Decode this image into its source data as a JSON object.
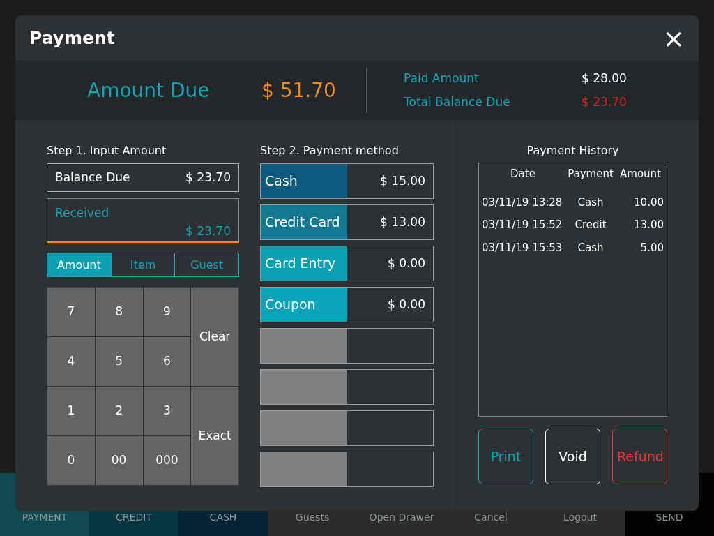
{
  "bottom_bar": [
    {
      "label": "PAYMENT",
      "color": "#0e4a50"
    },
    {
      "label": "CREDIT",
      "color": "#063640"
    },
    {
      "label": "CASH",
      "color": "#052535"
    },
    {
      "label": "Guests",
      "color": "#2b2b2b"
    },
    {
      "label": "Open Drawer",
      "color": "#2b2b2b"
    },
    {
      "label": "Cancel",
      "color": "#2b2b2b"
    },
    {
      "label": "Logout",
      "color": "#2b2b2b"
    },
    {
      "label": "SEND",
      "color": "#000000"
    }
  ],
  "dialog": {
    "title": "Payment",
    "close": "×",
    "summary": {
      "amount_due_label": "Amount Due",
      "amount_due": "$ 51.70",
      "paid_label": "Paid Amount",
      "paid": "$ 28.00",
      "balance_label": "Total Balance Due",
      "balance": "$ 23.70"
    },
    "step1": {
      "title": "Step 1. Input Amount",
      "balance_label": "Balance Due",
      "balance": "$ 23.70",
      "received_label": "Received",
      "received": "$ 23.70",
      "tabs": [
        {
          "label": "Amount",
          "selected": true
        },
        {
          "label": "Item",
          "selected": false
        },
        {
          "label": "Guest",
          "selected": false
        }
      ],
      "keys": [
        {
          "label": "7",
          "kind": "digit"
        },
        {
          "label": "8",
          "kind": "digit"
        },
        {
          "label": "9",
          "kind": "digit"
        },
        {
          "label": "Clear",
          "kind": "tall"
        },
        {
          "label": "4",
          "kind": "digit"
        },
        {
          "label": "5",
          "kind": "digit"
        },
        {
          "label": "6",
          "kind": "digit"
        },
        {
          "label": "1",
          "kind": "digit"
        },
        {
          "label": "2",
          "kind": "digit"
        },
        {
          "label": "3",
          "kind": "digit"
        },
        {
          "label": "Exact",
          "kind": "tall"
        },
        {
          "label": "0",
          "kind": "digit"
        },
        {
          "label": "00",
          "kind": "digit"
        },
        {
          "label": "000",
          "kind": "digit"
        }
      ]
    },
    "step2": {
      "title": "Step 2. Payment method",
      "methods": [
        {
          "kind": "method",
          "label": "Cash",
          "amount": "$ 15.00",
          "color": "#0d5a7e"
        },
        {
          "kind": "method",
          "label": "Credit Card",
          "amount": "$ 13.00",
          "color": "#127791"
        },
        {
          "kind": "method",
          "label": "Card Entry",
          "amount": "$ 0.00",
          "color": "#0aa0b4"
        },
        {
          "kind": "method",
          "label": "Coupon",
          "amount": "$ 0.00",
          "color": "#0aa4b8"
        },
        {
          "kind": "empty",
          "color": "#808080"
        },
        {
          "kind": "empty",
          "color": "#808080"
        },
        {
          "kind": "empty",
          "color": "#808080"
        },
        {
          "kind": "empty",
          "color": "#808080"
        }
      ]
    },
    "history": {
      "title": "Payment History",
      "columns": [
        "Date",
        "Payment",
        "Amount"
      ],
      "rows": [
        [
          "03/11/19 13:28",
          "Cash",
          "10.00"
        ],
        [
          "03/11/19 15:52",
          "Credit",
          "13.00"
        ],
        [
          "03/11/19 15:53",
          "Cash",
          "5.00"
        ]
      ]
    },
    "actions": [
      {
        "label": "Print",
        "color": "#12a3b5"
      },
      {
        "label": "Void",
        "color": "#ffffff"
      },
      {
        "label": "Refund",
        "color": "#e03a3a"
      }
    ]
  }
}
